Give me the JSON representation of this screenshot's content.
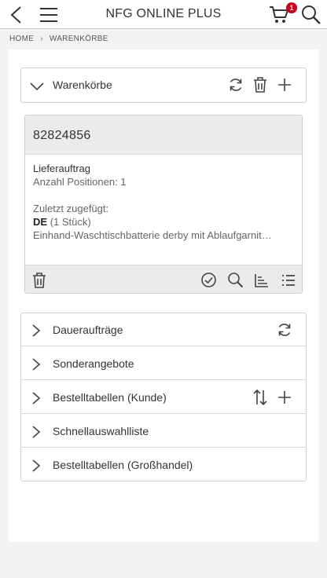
{
  "header": {
    "title": "NFG ONLINE PLUS",
    "cart_count": "1",
    "icons": [
      "back-icon",
      "menu-icon",
      "cart-icon",
      "search-icon"
    ]
  },
  "breadcrumb": {
    "home": "HOME",
    "current": "WARENKÖRBE"
  },
  "baskets_panel": {
    "title": "Warenkörbe",
    "icons": [
      "refresh-icon",
      "trash-icon",
      "plus-icon"
    ]
  },
  "basket": {
    "id": "82824856",
    "type": "Lieferauftrag",
    "positions": "Anzahl Positionen: 1",
    "last_added_label": "Zuletzt zugefügt:",
    "country": "DE",
    "quantity": "(1 Stück)",
    "product": "Einhand-Waschtischbatterie derby mit Ablaufgarnit…",
    "footer_icons": [
      "trash-icon",
      "check-circle-icon",
      "search-icon",
      "sort-icon",
      "list-icon"
    ]
  },
  "sections": [
    {
      "label": "Daueraufträge"
    },
    {
      "label": "Sonderangebote"
    },
    {
      "label": "Bestelltabellen (Kunde)"
    },
    {
      "label": "Schnellauswahlliste"
    },
    {
      "label": "Bestelltabellen (Großhandel)"
    }
  ],
  "colors": {
    "badge": "#c4001a",
    "icon": "#444444",
    "page_bg": "#f2f2f2"
  }
}
